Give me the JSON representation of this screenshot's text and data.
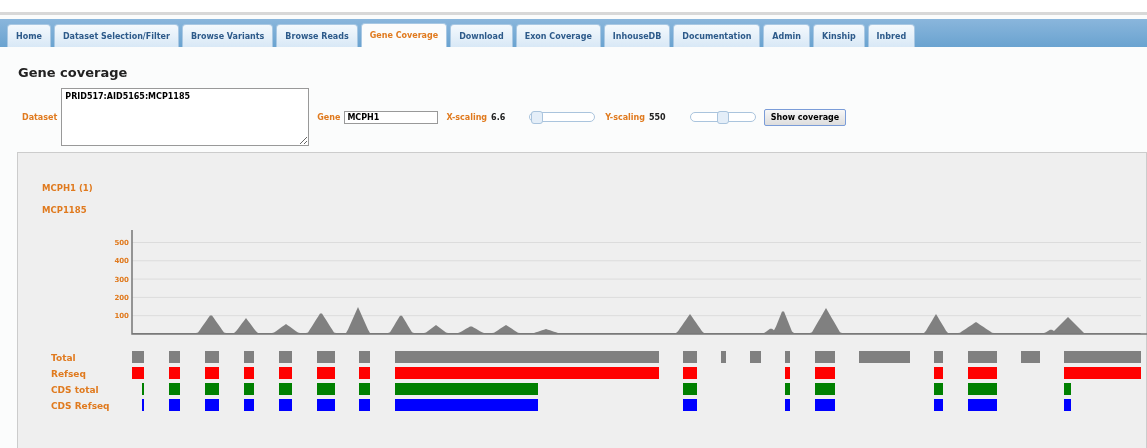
{
  "tabs": [
    {
      "label": "Home",
      "selected": false
    },
    {
      "label": "Dataset Selection/Filter",
      "selected": false
    },
    {
      "label": "Browse Variants",
      "selected": false
    },
    {
      "label": "Browse Reads",
      "selected": false
    },
    {
      "label": "Gene Coverage",
      "selected": true
    },
    {
      "label": "Download",
      "selected": false
    },
    {
      "label": "Exon Coverage",
      "selected": false
    },
    {
      "label": "InhouseDB",
      "selected": false
    },
    {
      "label": "Documentation",
      "selected": false
    },
    {
      "label": "Admin",
      "selected": false
    },
    {
      "label": "Kinship",
      "selected": false
    },
    {
      "label": "Inbred",
      "selected": false
    }
  ],
  "page_title": "Gene coverage",
  "form": {
    "dataset_label": "Dataset",
    "dataset_value": "PRID517:AID5165:MCP1185",
    "gene_label": "Gene",
    "gene_value": "MCPH1",
    "x_scaling": {
      "label": "X-scaling",
      "reading": "6.6",
      "level": 0.02
    },
    "y_scaling": {
      "label": "Y-scaling",
      "reading": "550",
      "level": 0.5
    },
    "button": "Show coverage"
  },
  "results": {
    "gene_heading": "MCPH1 (1)",
    "sample_heading": "MCP1185",
    "y_ticks": [
      "500",
      "400",
      "300",
      "200",
      "100"
    ],
    "tracks": [
      {
        "label": "Total",
        "color": "#808080"
      },
      {
        "label": "Refseq",
        "color": "#ff0000"
      },
      {
        "label": "CDS total",
        "color": "#008000"
      },
      {
        "label": "CDS Refseq",
        "color": "#0000ff"
      }
    ]
  }
}
